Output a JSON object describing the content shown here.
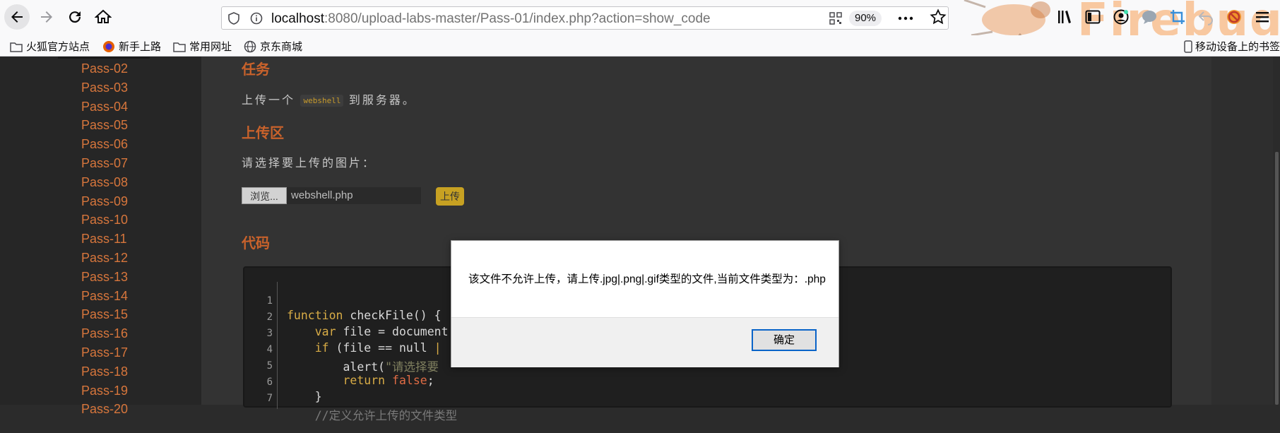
{
  "browser": {
    "url_host": "localhost",
    "url_rest": ":8080/upload-labs-master/Pass-01/index.php?action=show_code",
    "zoom": "90%",
    "firebug_watermark": "Firebug",
    "bookmarks": [
      "火狐官方站点",
      "新手上路",
      "常用网址",
      "京东商城"
    ],
    "mobile_bookmarks": "移动设备上的书签"
  },
  "sidebar": {
    "items": [
      "Pass-02",
      "Pass-03",
      "Pass-04",
      "Pass-05",
      "Pass-06",
      "Pass-07",
      "Pass-08",
      "Pass-09",
      "Pass-10",
      "Pass-11",
      "Pass-12",
      "Pass-13",
      "Pass-14",
      "Pass-15",
      "Pass-16",
      "Pass-17",
      "Pass-18",
      "Pass-19",
      "Pass-20"
    ]
  },
  "main": {
    "task_heading": "任务",
    "task_text_before": "上传一个",
    "task_code": "webshell",
    "task_text_after": "到服务器。",
    "upload_heading": "上传区",
    "upload_prompt": "请选择要上传的图片：",
    "browse_label": "浏览...",
    "file_name": "webshell.php",
    "upload_label": "上传",
    "code_heading": "代码"
  },
  "code": {
    "line_numbers": [
      "1",
      "2",
      "3",
      "4",
      "5",
      "6",
      "7"
    ],
    "l1_kw": "function",
    "l1_rest": " checkFile() {",
    "l2_kw": "var",
    "l2_rest": " file = document",
    "l3_kw": "if",
    "l3_rest": " (file == null ",
    "l3_bar": "|",
    "l4_fn": "alert(",
    "l4_str": "\"请选择要",
    "l5_kw": "return",
    "l5_val": "false",
    "l5_end": ";",
    "l6": "}",
    "l7": "//定义允许上传的文件类型"
  },
  "dialog": {
    "message": "该文件不允许上传，请上传.jpg|.png|.gif类型的文件,当前文件类型为：.php",
    "ok_label": "确定"
  }
}
